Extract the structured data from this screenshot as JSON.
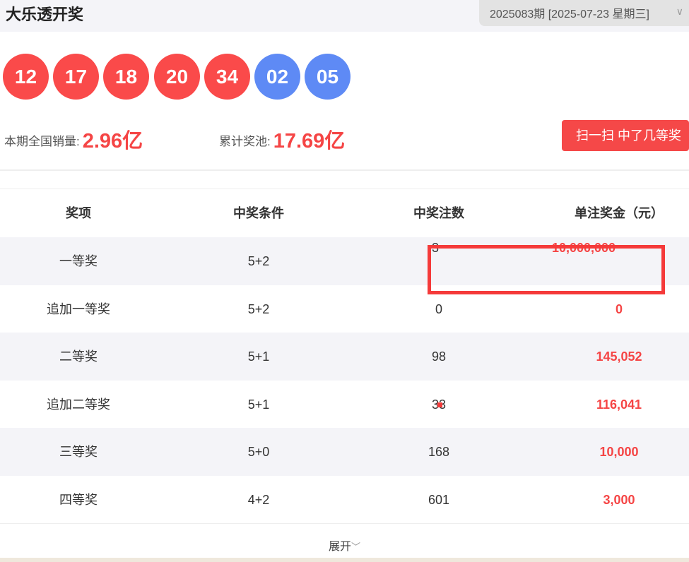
{
  "header": {
    "title": "大乐透开奖",
    "issue": "2025083期 [2025-07-23 星期三]"
  },
  "balls": {
    "front": [
      "12",
      "17",
      "18",
      "20",
      "34"
    ],
    "back": [
      "02",
      "05"
    ]
  },
  "stats": {
    "sales_label": "本期全国销量:",
    "sales_value": "2.96亿",
    "pool_label": "累计奖池:",
    "pool_value": "17.69亿"
  },
  "scan_button": "扫一扫 中了几等奖",
  "table": {
    "headers": [
      "奖项",
      "中奖条件",
      "中奖注数",
      "单注奖金（元）"
    ],
    "rows": [
      [
        "一等奖",
        "5+2",
        "3",
        "10,000,000"
      ],
      [
        "追加一等奖",
        "5+2",
        "0",
        "0"
      ],
      [
        "二等奖",
        "5+1",
        "98",
        "145,052"
      ],
      [
        "追加二等奖",
        "5+1",
        "33",
        "116,041"
      ],
      [
        "三等奖",
        "5+0",
        "168",
        "10,000"
      ],
      [
        "四等奖",
        "4+2",
        "601",
        "3,000"
      ]
    ]
  },
  "expand": "展开",
  "colors": {
    "red": "#fa4a4a",
    "blue": "#5e8af5"
  }
}
